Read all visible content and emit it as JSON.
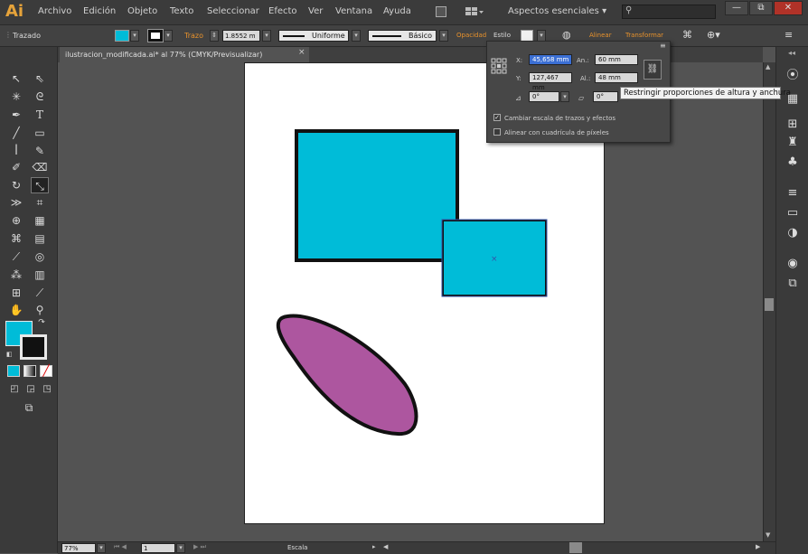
{
  "app": {
    "logo": "Ai"
  },
  "menu": [
    "Archivo",
    "Edición",
    "Objeto",
    "Texto",
    "Seleccionar",
    "Efecto",
    "Ver",
    "Ventana",
    "Ayuda"
  ],
  "workspace": {
    "label": "Aspectos esenciales"
  },
  "window_buttons": {
    "minimize": "—",
    "maximize": "⧉",
    "close": "✕"
  },
  "control_bar": {
    "selection": "Trazado",
    "stroke_label": "Trazo",
    "stroke_value": "1.8552 m",
    "stroke_profile": "Uniforme",
    "brush": "Básico",
    "opacity_label": "Opacidad",
    "style_label": "Estilo",
    "align_label": "Alinear",
    "transform_label": "Transformar",
    "fill_color": "#00bcd8"
  },
  "document_tab": {
    "title": "ilustracion_modificada.ai* al 77% (CMYK/Previsualizar)",
    "close": "×"
  },
  "transform_panel": {
    "x_label": "X:",
    "x_value": "45,658 mm",
    "y_label": "Y:",
    "y_value": "127,467 mm",
    "w_label": "An.:",
    "w_value": "60 mm",
    "h_label": "Al.:",
    "h_value": "48 mm",
    "rotate_value": "0°",
    "shear_value": "0°",
    "scale_strokes_label": "Cambiar escala de trazos y efectos",
    "scale_strokes_checked": true,
    "pixel_grid_label": "Alinear con cuadrícula de píxeles",
    "pixel_grid_checked": false
  },
  "tooltip": "Restringir proporciones de altura y anchura",
  "status_bar": {
    "zoom": "77%",
    "artboard": "1",
    "tool": "Escala"
  },
  "colors": {
    "cyan": "#00bcd8",
    "purple": "#ad569f",
    "stroke": "#111111"
  },
  "tool_icons": [
    "selection-icon",
    "direct-selection-icon",
    "magic-wand-icon",
    "lasso-icon",
    "pen-icon",
    "type-icon",
    "line-icon",
    "rectangle-icon",
    "paintbrush-icon",
    "pencil-icon",
    "blob-brush-icon",
    "eraser-icon",
    "rotate-icon",
    "scale-icon",
    "width-icon",
    "free-transform-icon",
    "shape-builder-icon",
    "perspective-icon",
    "mesh-icon",
    "gradient-icon",
    "eyedropper-icon",
    "blend-icon",
    "symbol-sprayer-icon",
    "graph-icon",
    "artboard-icon",
    "slice-icon",
    "hand-icon",
    "zoom-icon"
  ]
}
